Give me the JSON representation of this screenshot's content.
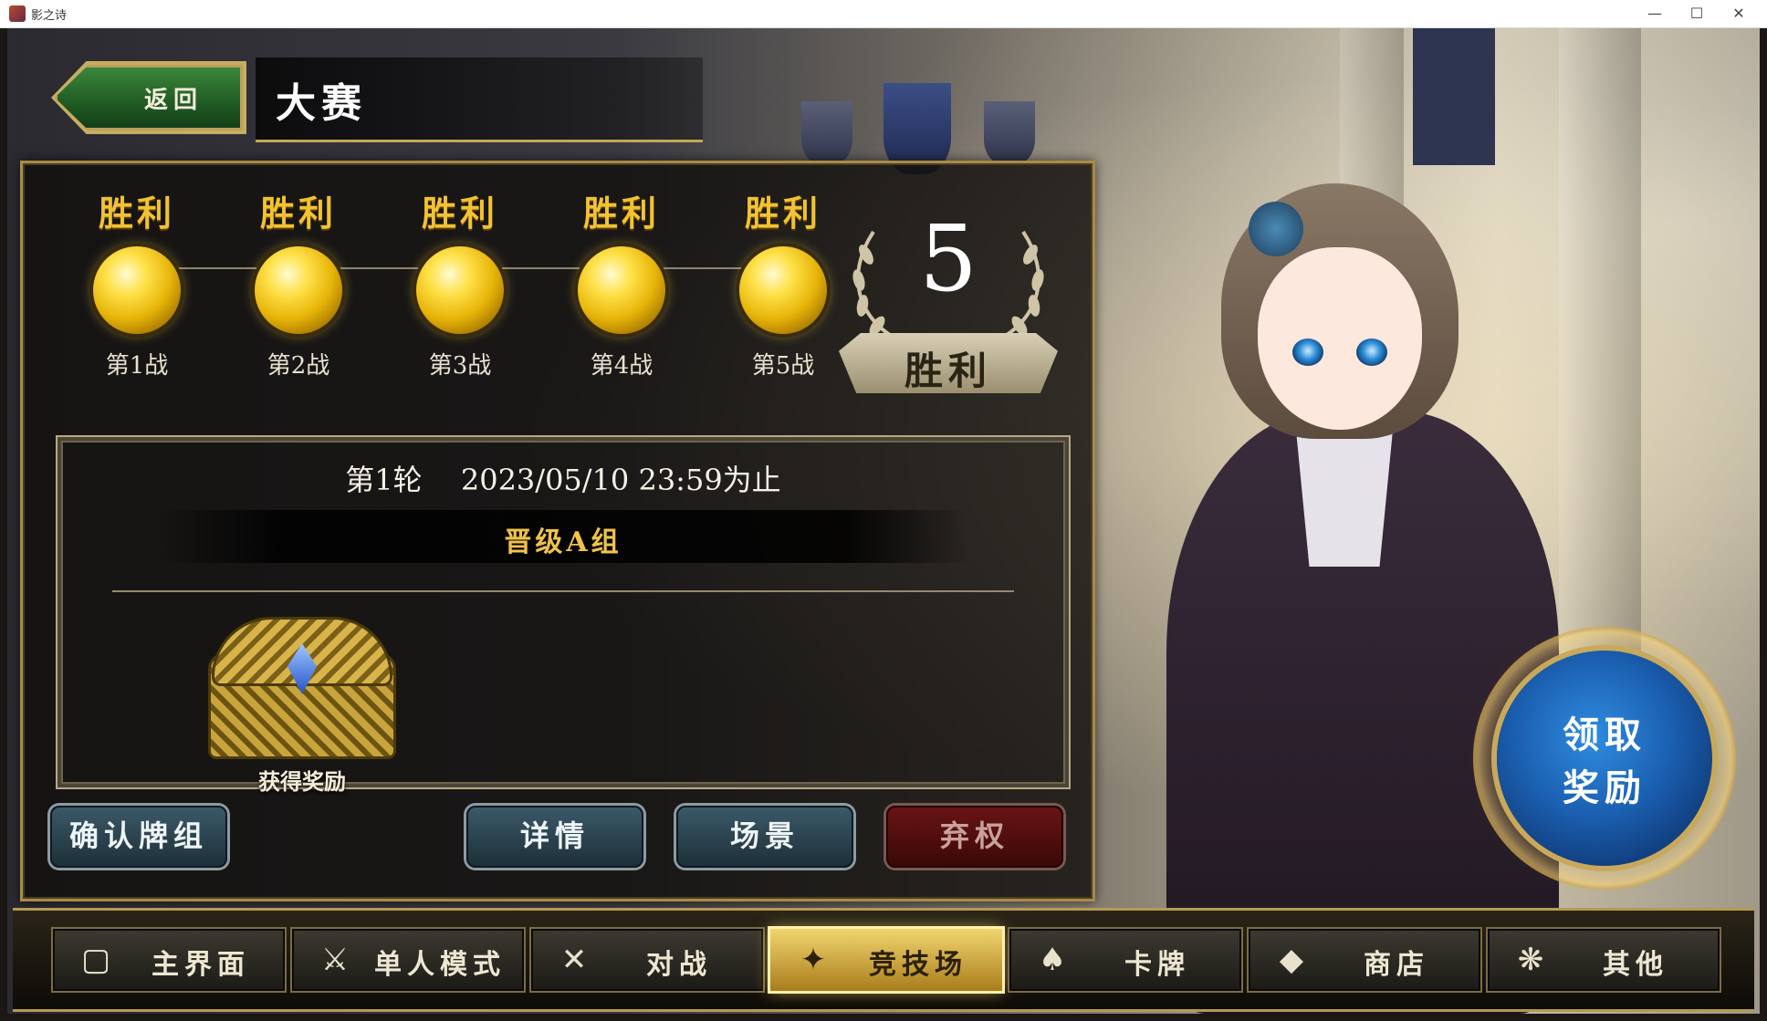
{
  "window": {
    "title": "影之诗",
    "minimize": "—",
    "maximize": "☐",
    "close": "✕"
  },
  "header": {
    "back_label": "返回",
    "page_title": "大赛"
  },
  "battles": [
    {
      "result": "胜利",
      "label": "第1战"
    },
    {
      "result": "胜利",
      "label": "第2战"
    },
    {
      "result": "胜利",
      "label": "第3战"
    },
    {
      "result": "胜利",
      "label": "第4战"
    },
    {
      "result": "胜利",
      "label": "第5战"
    }
  ],
  "wins": {
    "count": "5",
    "label": "胜利"
  },
  "round": {
    "name": "第1轮",
    "deadline": "2023/05/10 23:59为止",
    "group": "晋级A组"
  },
  "reward": {
    "label": "获得奖励",
    "claim_line1": "领取",
    "claim_line2": "奖励"
  },
  "actions": {
    "confirm_deck": "确认牌组",
    "details": "详情",
    "scene": "场景",
    "forfeit": "弃权"
  },
  "nav": [
    {
      "label": "主界面",
      "icon": "home-card-icon",
      "glyph": "▢"
    },
    {
      "label": "单人模式",
      "icon": "sword-shield-icon",
      "glyph": "⚔"
    },
    {
      "label": "对战",
      "icon": "crossed-swords-icon",
      "glyph": "✕"
    },
    {
      "label": "竞技场",
      "icon": "arena-icon",
      "glyph": "✦"
    },
    {
      "label": "卡牌",
      "icon": "cards-icon",
      "glyph": "♠"
    },
    {
      "label": "商店",
      "icon": "shop-icon",
      "glyph": "◆"
    },
    {
      "label": "其他",
      "icon": "other-icon",
      "glyph": "❋"
    }
  ],
  "active_nav": "竞技场",
  "colors": {
    "gold": "#f1c232",
    "accent_blue": "#1b5fb0",
    "frame_gold": "#a88c46"
  }
}
